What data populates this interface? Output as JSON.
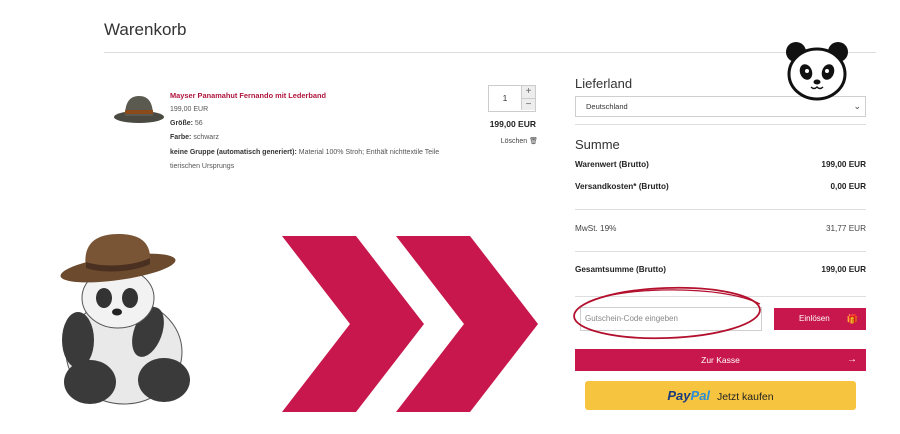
{
  "page": {
    "title": "Warenkorb"
  },
  "item": {
    "name": "Mayser Panamahut Fernando mit Lederband",
    "unit_price": "199,00 EUR",
    "size_label": "Größe:",
    "size_value": "56",
    "color_label": "Farbe:",
    "color_value": "schwarz",
    "group_label": "keine Gruppe (automatisch generiert):",
    "group_value": "Material 100% Stroh; Enthält nichttextile Teile",
    "group_value_2": "tierischen Ursprungs",
    "quantity": "1",
    "total": "199,00 EUR",
    "delete_label": "Löschen"
  },
  "shipping": {
    "heading": "Lieferland",
    "country": "Deutschland"
  },
  "summary": {
    "heading": "Summe",
    "goods_label": "Warenwert (Brutto)",
    "goods_value": "199,00 EUR",
    "shipping_label": "Versandkosten* (Brutto)",
    "shipping_value": "0,00 EUR",
    "vat_label": "MwSt. 19%",
    "vat_value": "31,77 EUR",
    "total_label": "Gesamtsumme (Brutto)",
    "total_value": "199,00 EUR"
  },
  "voucher": {
    "placeholder": "Gutschein-Code eingeben",
    "redeem_label": "Einlösen"
  },
  "checkout": {
    "label": "Zur Kasse"
  },
  "paypal": {
    "brand_part1": "Pay",
    "brand_part2": "Pal",
    "label": "Jetzt kaufen"
  },
  "colors": {
    "accent": "#c8174c",
    "paypal_yellow": "#f6c43e",
    "circle_red": "#b3102e"
  },
  "icons": {
    "delete": "trash-icon",
    "redeem": "gift-icon",
    "checkout": "arrow-right-icon",
    "select": "chevron-down-icon"
  }
}
